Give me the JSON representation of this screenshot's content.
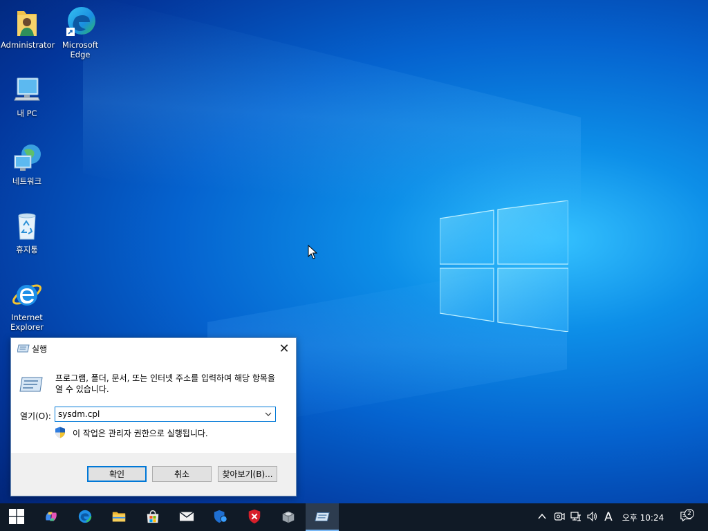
{
  "desktop": {
    "icons": [
      {
        "label": "Administrator"
      },
      {
        "label": "Microsoft Edge"
      },
      {
        "label": "내 PC"
      },
      {
        "label": "네트워크"
      },
      {
        "label": "휴지통"
      },
      {
        "label": "Internet Explorer"
      }
    ]
  },
  "run_dialog": {
    "title": "실행",
    "description": "프로그램, 폴더, 문서, 또는 인터넷 주소를 입력하여 해당 항목을 열 수 있습니다.",
    "open_label": "열기(O):",
    "open_value": "sysdm.cpl",
    "admin_note": "이 작업은 관리자 권한으로 실행됩니다.",
    "ok_label": "확인",
    "cancel_label": "취소",
    "browse_label": "찾아보기(B)..."
  },
  "taskbar": {
    "apps": [
      "start",
      "copilot",
      "edge",
      "file-explorer",
      "store",
      "mail",
      "defender",
      "security",
      "app-package",
      "run"
    ],
    "tray": {
      "ime_label": "A",
      "clock": "오후 10:24",
      "notification_count": "2"
    }
  },
  "colors": {
    "accent": "#0078d7",
    "taskbar": "#101a26"
  }
}
